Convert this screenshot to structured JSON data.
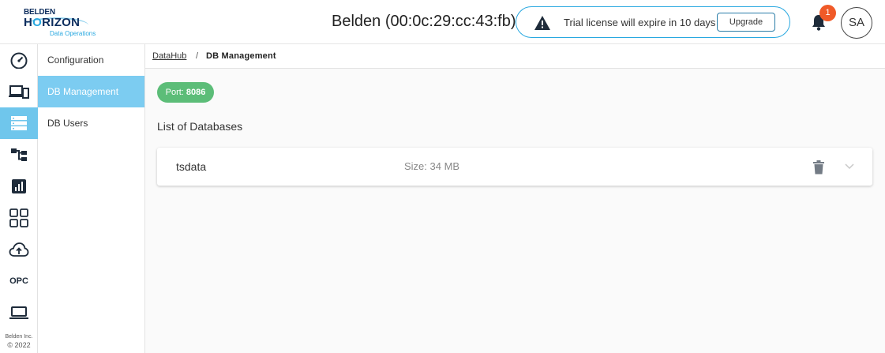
{
  "header": {
    "logo": {
      "line1": "BELDEN",
      "line2_prefix": "H",
      "line2_o": "O",
      "line2_suffix": "RIZON",
      "line3": "Data Operations"
    },
    "device_title": "Belden (00:0c:29:cc:43:fb)",
    "trial_banner": {
      "text": "Trial license will expire in 10 days",
      "button_label": "Upgrade"
    },
    "notification_count": "1",
    "avatar_initials": "SA"
  },
  "rail": {
    "items": [
      {
        "icon": "dashboard-gauge-icon"
      },
      {
        "icon": "devices-icon"
      },
      {
        "icon": "database-icon",
        "active": true
      },
      {
        "icon": "hierarchy-icon"
      },
      {
        "icon": "chart-icon"
      },
      {
        "icon": "apps-grid-icon"
      },
      {
        "icon": "cloud-upload-icon"
      },
      {
        "icon": "opc-label",
        "label": "OPC"
      },
      {
        "icon": "laptop-icon"
      }
    ],
    "copyright_line1": "Belden Inc.",
    "copyright_line2": "© 2022"
  },
  "submenu": {
    "items": [
      {
        "label": "Configuration"
      },
      {
        "label": "DB Management",
        "active": true
      },
      {
        "label": "DB Users"
      }
    ]
  },
  "breadcrumb": {
    "link": "DataHub",
    "separator": "/",
    "current": "DB Management"
  },
  "main": {
    "port_label": "Port:",
    "port_value": "8086",
    "section_title": "List of Databases",
    "databases": [
      {
        "name": "tsdata",
        "size": "Size: 34 MB"
      }
    ]
  },
  "colors": {
    "accent": "#29a8e0",
    "active_menu": "#7cccf1",
    "badge": "#f05a28",
    "port_badge": "#5cbd78",
    "navy": "#0d2d5e"
  }
}
